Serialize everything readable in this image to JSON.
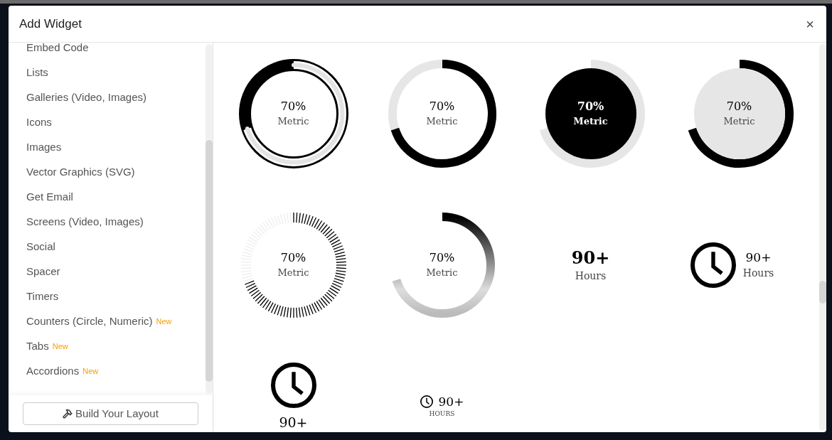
{
  "window": {
    "title": "Add Widget",
    "close": "×"
  },
  "sidebar": {
    "items": [
      {
        "label": "Embed Code"
      },
      {
        "label": "Lists"
      },
      {
        "label": "Galleries (Video, Images)"
      },
      {
        "label": "Icons"
      },
      {
        "label": "Images"
      },
      {
        "label": "Vector Graphics (SVG)"
      },
      {
        "label": "Get Email"
      },
      {
        "label": "Screens (Video, Images)"
      },
      {
        "label": "Social"
      },
      {
        "label": "Spacer"
      },
      {
        "label": "Timers"
      },
      {
        "label": "Counters (Circle, Numeric)",
        "badge": "New"
      },
      {
        "label": "Tabs",
        "badge": "New"
      },
      {
        "label": "Accordions",
        "badge": "New"
      }
    ],
    "button": "Build Your Layout"
  },
  "widgets": [
    {
      "kind": "ring-inset",
      "value": "70%",
      "label": "Metric"
    },
    {
      "kind": "ring",
      "value": "70%",
      "label": "Metric"
    },
    {
      "kind": "ring-dark",
      "value": "70%",
      "label": "Metric"
    },
    {
      "kind": "ring-light",
      "value": "70%",
      "label": "Metric"
    },
    {
      "kind": "ticks",
      "value": "70%",
      "label": "Metric"
    },
    {
      "kind": "gradient",
      "value": "70%",
      "label": "Metric"
    },
    {
      "kind": "number",
      "value": "90+",
      "label": "Hours"
    },
    {
      "kind": "clock-side",
      "value": "90+",
      "label": "Hours"
    },
    {
      "kind": "clock-top",
      "value": "90+"
    },
    {
      "kind": "clock-small",
      "value": "90+",
      "label": "HOURS"
    }
  ]
}
